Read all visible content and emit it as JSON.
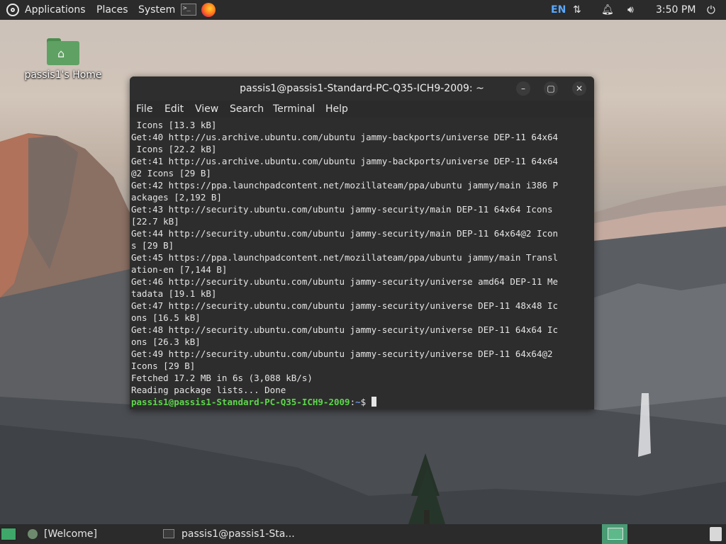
{
  "top_panel": {
    "menus": [
      "Applications",
      "Places",
      "System"
    ],
    "language": "EN",
    "clock": "3:50 PM"
  },
  "desktop": {
    "home_icon_label": "passis1's Home"
  },
  "terminal": {
    "title": "passis1@passis1-Standard-PC-Q35-ICH9-2009: ~",
    "menu": [
      "File",
      "Edit",
      "View",
      "Search",
      "Terminal",
      "Help"
    ],
    "output_lines": [
      " Icons [13.3 kB]",
      "Get:40 http://us.archive.ubuntu.com/ubuntu jammy-backports/universe DEP-11 64x64",
      " Icons [22.2 kB]",
      "Get:41 http://us.archive.ubuntu.com/ubuntu jammy-backports/universe DEP-11 64x64",
      "@2 Icons [29 B]",
      "Get:42 https://ppa.launchpadcontent.net/mozillateam/ppa/ubuntu jammy/main i386 P",
      "ackages [2,192 B]",
      "Get:43 http://security.ubuntu.com/ubuntu jammy-security/main DEP-11 64x64 Icons",
      "[22.7 kB]",
      "Get:44 http://security.ubuntu.com/ubuntu jammy-security/main DEP-11 64x64@2 Icon",
      "s [29 B]",
      "Get:45 https://ppa.launchpadcontent.net/mozillateam/ppa/ubuntu jammy/main Transl",
      "ation-en [7,144 B]",
      "Get:46 http://security.ubuntu.com/ubuntu jammy-security/universe amd64 DEP-11 Me",
      "tadata [19.1 kB]",
      "Get:47 http://security.ubuntu.com/ubuntu jammy-security/universe DEP-11 48x48 Ic",
      "ons [16.5 kB]",
      "Get:48 http://security.ubuntu.com/ubuntu jammy-security/universe DEP-11 64x64 Ic",
      "ons [26.3 kB]",
      "Get:49 http://security.ubuntu.com/ubuntu jammy-security/universe DEP-11 64x64@2",
      "Icons [29 B]",
      "Fetched 17.2 MB in 6s (3,088 kB/s)",
      "Reading package lists... Done"
    ],
    "prompt": {
      "user_host": "passis1@passis1-Standard-PC-Q35-ICH9-2009",
      "separator": ":",
      "path": "~",
      "symbol": "$"
    }
  },
  "taskbar": {
    "tasks": [
      "[Welcome]",
      "passis1@passis1-Sta..."
    ]
  },
  "colors": {
    "prompt_user": "#5bd84a",
    "prompt_path": "#6b8fe0",
    "panel": "#2b2b2b",
    "folder": "#5fa163"
  }
}
